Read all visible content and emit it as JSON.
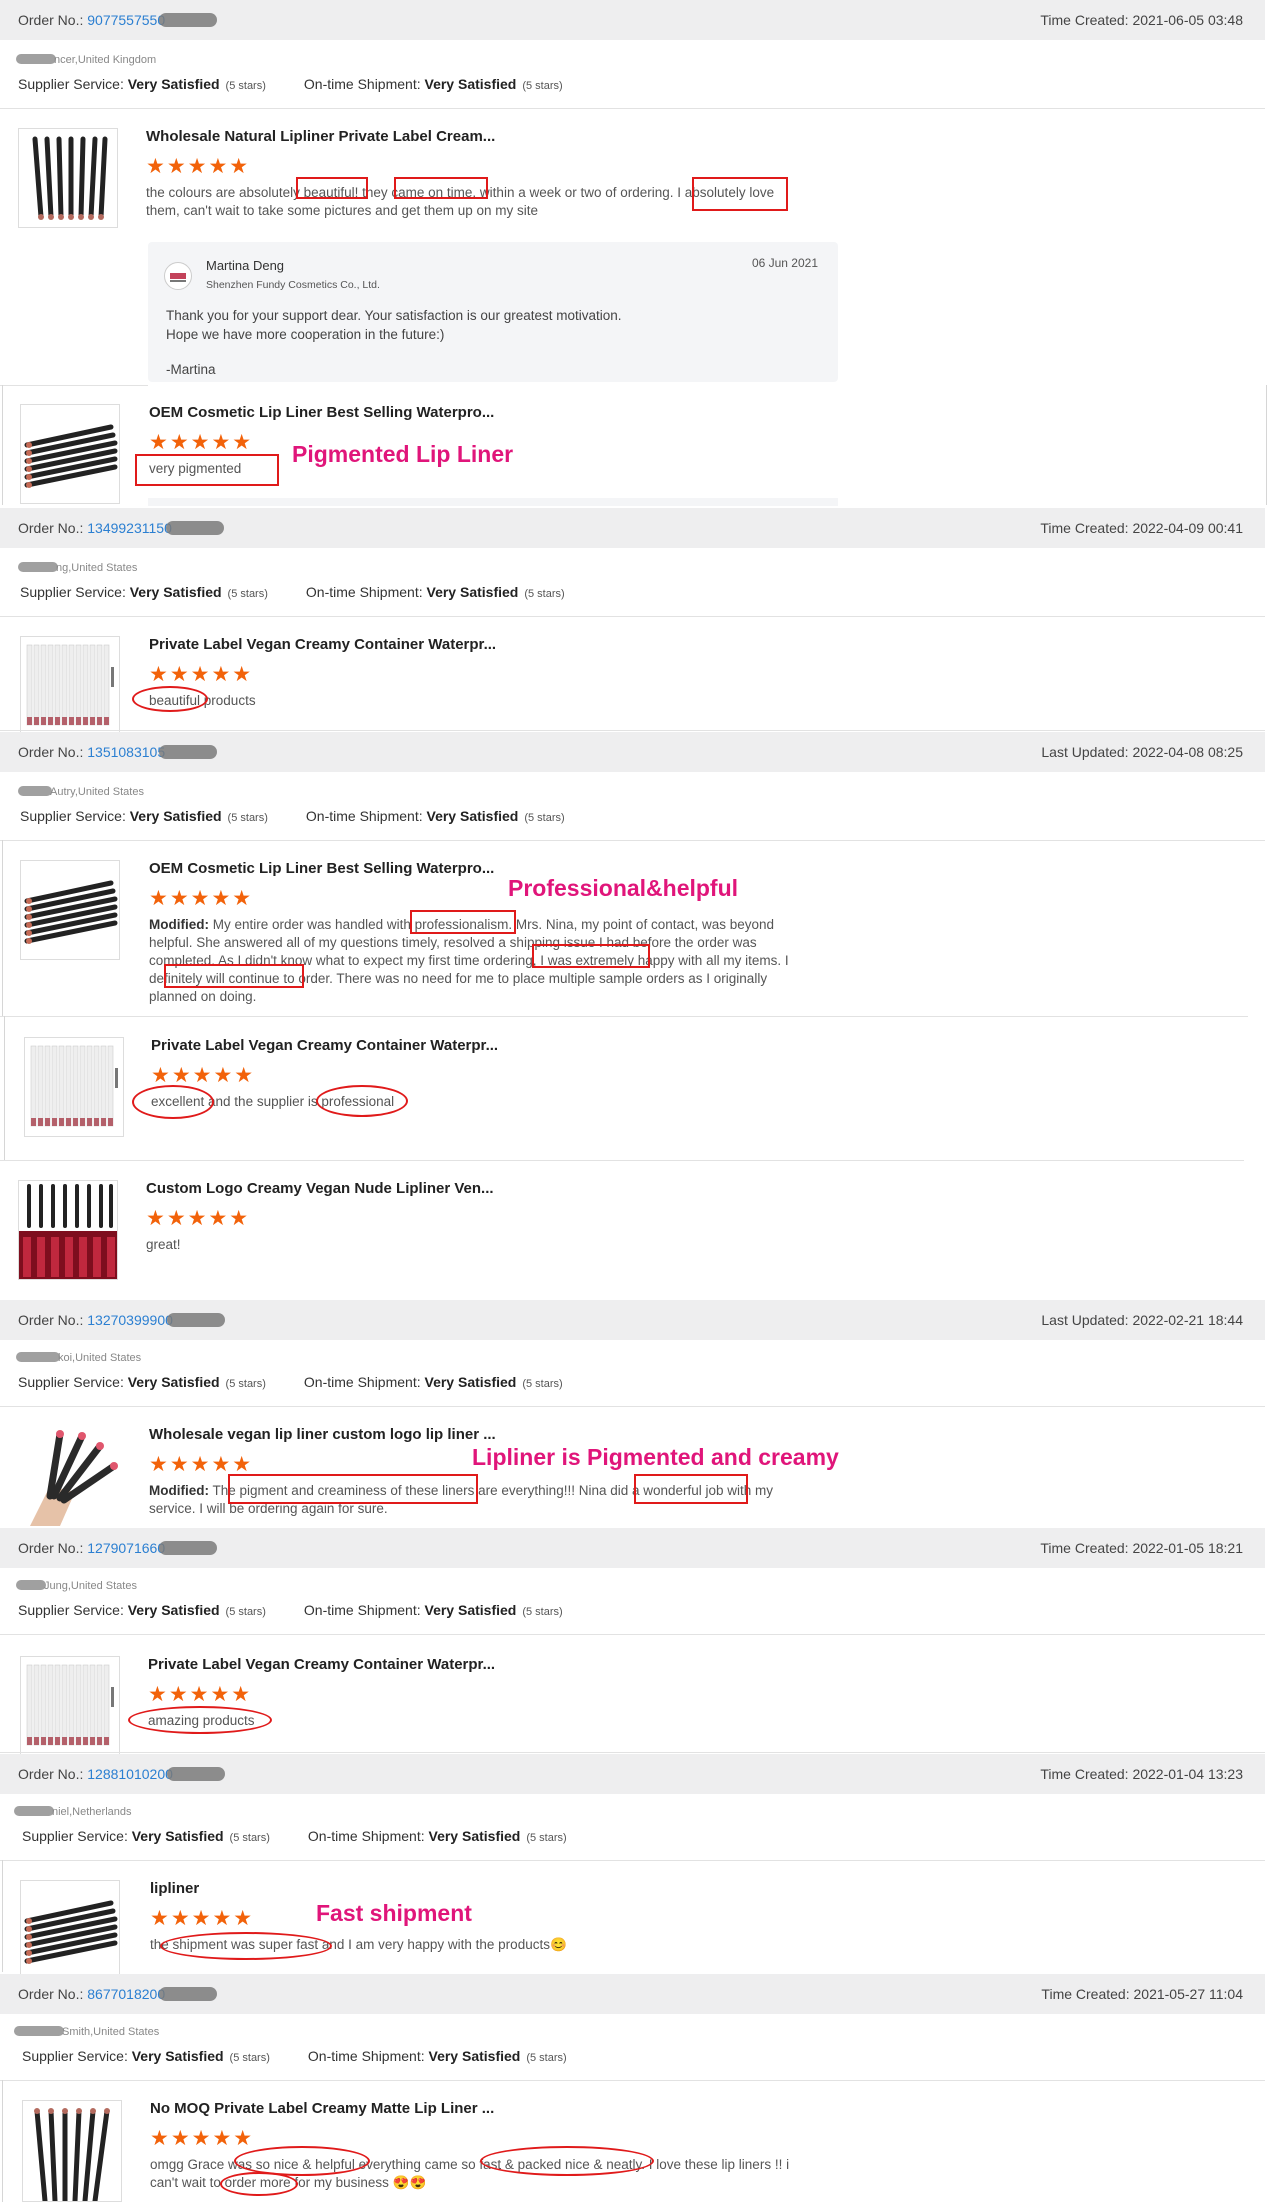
{
  "orders": [
    {
      "order_label": "Order No.:",
      "order_no": "9077557550",
      "time_label": "Time Created:",
      "time": "2021-06-05 03:48",
      "buyer": "ncer,United Kingdom",
      "supplier_label": "Supplier Service:",
      "supplier_value": "Very Satisfied",
      "supplier_stars": "(5 stars)",
      "ship_label": "On-time Shipment:",
      "ship_value": "Very Satisfied",
      "ship_stars": "(5 stars)"
    },
    {
      "order_label": "Order No.:",
      "order_no": "13499231150",
      "time_label": "Time Created:",
      "time": "2022-04-09 00:41",
      "buyer": "ng,United States",
      "supplier_label": "Supplier Service:",
      "supplier_value": "Very Satisfied",
      "supplier_stars": "(5 stars)",
      "ship_label": "On-time Shipment:",
      "ship_value": "Very Satisfied",
      "ship_stars": "(5 stars)"
    },
    {
      "order_label": "Order No.:",
      "order_no": "1351083105",
      "time_label": "Last Updated:",
      "time": "2022-04-08 08:25",
      "buyer": "Autry,United States",
      "supplier_label": "Supplier Service:",
      "supplier_value": "Very Satisfied",
      "supplier_stars": "(5 stars)",
      "ship_label": "On-time Shipment:",
      "ship_value": "Very Satisfied",
      "ship_stars": "(5 stars)"
    },
    {
      "order_label": "Order No.:",
      "order_no": "13270399900",
      "time_label": "Last Updated:",
      "time": "2022-02-21 18:44",
      "buyer": "koi,United States",
      "supplier_label": "Supplier Service:",
      "supplier_value": "Very Satisfied",
      "supplier_stars": "(5 stars)",
      "ship_label": "On-time Shipment:",
      "ship_value": "Very Satisfied",
      "ship_stars": "(5 stars)"
    },
    {
      "order_label": "Order No.:",
      "order_no": "1279071660",
      "time_label": "Time Created:",
      "time": "2022-01-05 18:21",
      "buyer": "Jung,United States",
      "supplier_label": "Supplier Service:",
      "supplier_value": "Very Satisfied",
      "supplier_stars": "(5 stars)",
      "ship_label": "On-time Shipment:",
      "ship_value": "Very Satisfied",
      "ship_stars": "(5 stars)"
    },
    {
      "order_label": "Order No.:",
      "order_no": "12881010200",
      "time_label": "Time Created:",
      "time": "2022-01-04 13:23",
      "buyer": "niel,Netherlands",
      "supplier_label": "Supplier Service:",
      "supplier_value": "Very Satisfied",
      "supplier_stars": "(5 stars)",
      "ship_label": "On-time Shipment:",
      "ship_value": "Very Satisfied",
      "ship_stars": "(5 stars)"
    },
    {
      "order_label": "Order No.:",
      "order_no": "8677018200",
      "time_label": "Time Created:",
      "time": "2021-05-27 11:04",
      "buyer": "Smith,United States",
      "supplier_label": "Supplier Service:",
      "supplier_value": "Very Satisfied",
      "supplier_stars": "(5 stars)",
      "ship_label": "On-time Shipment:",
      "ship_value": "Very Satisfied",
      "ship_stars": "(5 stars)"
    }
  ],
  "items": [
    {
      "title": "Wholesale Natural Lipliner Private Label Cream...",
      "comment": "the colours are absolutely beautiful! they came on time, within a week or two of ordering. I absolutely love them, can't wait to take some pictures and get them up on my site",
      "rating": "★★★★★"
    },
    {
      "title": "OEM Cosmetic Lip Liner Best Selling Waterpro...",
      "comment": "very pigmented",
      "rating": "★★★★★"
    },
    {
      "title": "Private Label Vegan Creamy Container Waterpr...",
      "comment": "beautiful products",
      "rating": "★★★★★"
    },
    {
      "title": "OEM Cosmetic Lip Liner Best Selling Waterpro...",
      "modified": "Modified:",
      "comment": "My entire order was handled with professionalism. Mrs. Nina, my point of contact, was beyond helpful. She answered all of my questions timely, resolved a shipping issue I had before the order was completed. As I didn't know what to expect my first time ordering, I was extremely happy with all my items. I definitely will continue to order. There was no need for me to place multiple sample orders as I originally planned on doing.",
      "rating": "★★★★★"
    },
    {
      "title": "Private Label Vegan Creamy Container Waterpr...",
      "comment": "excellent and the supplier is professional",
      "rating": "★★★★★"
    },
    {
      "title": "Custom Logo Creamy Vegan Nude Lipliner Ven...",
      "comment": "great!",
      "rating": "★★★★★"
    },
    {
      "title": "Wholesale vegan lip liner custom logo lip liner ...",
      "modified": "Modified:",
      "comment": "The pigment and creaminess of these liners are everything!!! Nina did a wonderful job with my service. I will be ordering again for sure.",
      "rating": "★★★★★"
    },
    {
      "title": "Private Label Vegan Creamy Container Waterpr...",
      "comment": "amazing products",
      "rating": "★★★★★"
    },
    {
      "title": "lipliner",
      "comment": "the shipment was super fast and I am very happy with the products😊",
      "rating": "★★★★★"
    },
    {
      "title": "No MOQ Private Label Creamy Matte Lip Liner ...",
      "comment": "omgg Grace was so nice & helpful everything came so fast & packed nice & neatly. I love these lip liners !! i can't wait to order more for my business 😍😍",
      "rating": "★★★★★"
    }
  ],
  "reply": {
    "name": "Martina Deng",
    "company": "Shenzhen Fundy Cosmetics Co., Ltd.",
    "date": "06 Jun 2021",
    "line1": "Thank you for your support dear. Your satisfaction is our greatest motivation.",
    "line2": "Hope we have more cooperation in the future:)",
    "sign": "-Martina"
  },
  "annotations": {
    "a1": "Pigmented Lip Liner",
    "a2": "Professional&helpful",
    "a3": "Lipliner is Pigmented and creamy",
    "a4": "Fast shipment"
  },
  "colors": {
    "accent": "#f2620a",
    "link": "#2b7fd1",
    "annotation": "#e0157a",
    "highlight": "#e01a1a"
  }
}
